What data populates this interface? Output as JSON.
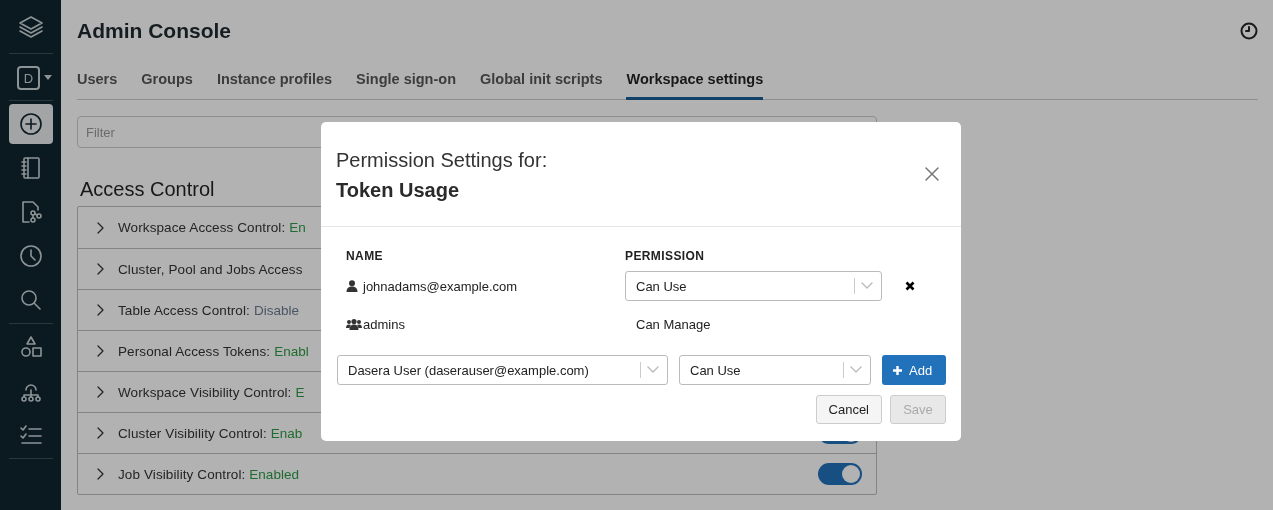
{
  "sidebar": {
    "avatar": {
      "letter": "D"
    },
    "items": [
      {
        "kind": "create",
        "selected": true
      },
      {
        "kind": "notebook",
        "selected": false
      },
      {
        "kind": "repos",
        "selected": false
      },
      {
        "kind": "history",
        "selected": false
      },
      {
        "kind": "search",
        "selected": false
      },
      {
        "kind": "shapes",
        "selected": false
      },
      {
        "kind": "tree",
        "selected": false
      },
      {
        "kind": "checklist",
        "selected": false
      }
    ]
  },
  "header": {
    "title": "Admin Console"
  },
  "tabs": [
    {
      "label": "Users",
      "selected": false
    },
    {
      "label": "Groups",
      "selected": false
    },
    {
      "label": "Instance profiles",
      "selected": false
    },
    {
      "label": "Single sign-on",
      "selected": false
    },
    {
      "label": "Global init scripts",
      "selected": false
    },
    {
      "label": "Workspace settings",
      "selected": true
    }
  ],
  "filter": {
    "placeholder": "Filter"
  },
  "section_title": "Access Control",
  "access_rows": [
    {
      "label": "Workspace Access Control:",
      "status": "En",
      "color": "#1f6b30"
    },
    {
      "label": "Cluster, Pool and Jobs Access"
    },
    {
      "label": "Table Access Control:",
      "status": "Disable",
      "color": "#4a5563"
    },
    {
      "label": "Personal Access Tokens:",
      "status": "Enabl",
      "color": "#1f6b30"
    },
    {
      "label": "Workspace Visibility Control:",
      "status": "E",
      "color": "#1f6b30"
    },
    {
      "label": "Cluster Visibility Control:",
      "status": "Enab",
      "color": "#1f6b30",
      "toggle": {
        "on": true
      }
    },
    {
      "label": "Job Visibility Control:",
      "status": "Enabled",
      "color": "#1f6b30",
      "toggle": {
        "on": true
      }
    }
  ],
  "modal": {
    "title": "Permission Settings for:",
    "subtitle": "Token Usage",
    "columns": [
      "NAME",
      "PERMISSION"
    ],
    "entries": [
      {
        "kind": "user",
        "name": "johnadams@example.com",
        "permission": "Can Use",
        "editable": true
      },
      {
        "kind": "group",
        "name": "admins",
        "permission": "Can Manage",
        "editable": false
      }
    ],
    "add_row": {
      "principal": "Dasera User (daserauser@example.com)",
      "permission": "Can Use",
      "add_label": "Add"
    },
    "buttons": [
      {
        "label": "Cancel",
        "disabled": false
      },
      {
        "label": "Save",
        "disabled": true
      }
    ]
  }
}
